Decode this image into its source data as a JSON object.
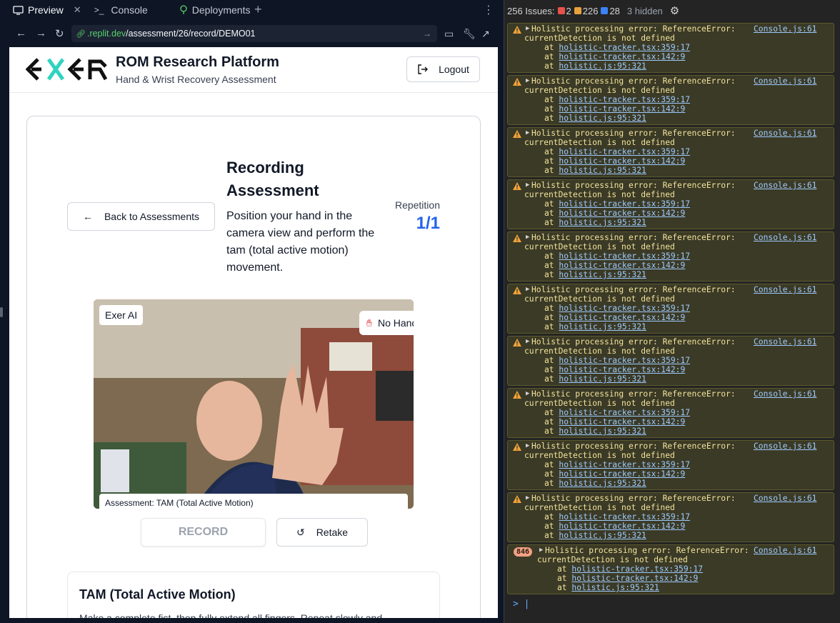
{
  "tabs": [
    {
      "label": "Preview",
      "icon": "monitor-icon"
    },
    {
      "label": "Console",
      "icon": "terminal-icon"
    },
    {
      "label": "Deployments",
      "icon": "deploy-icon"
    }
  ],
  "url": {
    "domain": ".replit.dev",
    "path": "/assessment/26/record/DEMO01"
  },
  "app": {
    "title": "ROM Research Platform",
    "subtitle": "Hand & Wrist Recovery Assessment",
    "logout": "Logout",
    "back": "Back to Assessments",
    "rec_title": "Recording Assessment",
    "rec_desc": "Position your hand in the camera view and perform the tam (total active motion) movement.",
    "rep_label": "Repetition",
    "rep_value": "1/1",
    "ai_badge": "Exer AI",
    "nohand": "No Hand",
    "caption": "Assessment: TAM (Total Active Motion)",
    "record": "RECORD",
    "retake": "Retake",
    "instr_title": "TAM (Total Active Motion)",
    "instr_text": "Make a complete fist, then fully extend all fingers. Repeat slowly and"
  },
  "console": {
    "issues_label": "256 Issues:",
    "err_count": "2",
    "warn_count": "226",
    "info_count": "28",
    "hidden": "3 hidden",
    "colors": {
      "err": "#e5534b",
      "warn": "#e8a13a",
      "info": "#3b82f6"
    },
    "msg_line1": "Holistic processing error: ReferenceError:",
    "msg_line2": "currentDetection is not defined",
    "source": "Console.js:61",
    "stack": [
      {
        "at": "at ",
        "loc": "holistic-tracker.tsx:359:17"
      },
      {
        "at": "at ",
        "loc": "holistic-tracker.tsx:142:9"
      },
      {
        "at": "at ",
        "loc": "holistic.js:95:321"
      }
    ],
    "last_count": "846",
    "prompt": ">"
  }
}
